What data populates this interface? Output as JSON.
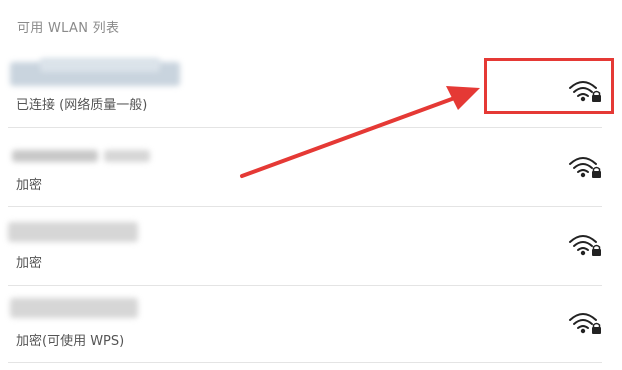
{
  "section": {
    "title": "可用 WLAN 列表"
  },
  "networks": [
    {
      "status": "已连接 (网络质量一般)",
      "icon": "wifi-lock-icon"
    },
    {
      "status": "加密",
      "icon": "wifi-lock-icon"
    },
    {
      "status": "加密",
      "icon": "wifi-lock-icon"
    },
    {
      "status": "加密(可使用 WPS)",
      "icon": "wifi-lock-icon"
    }
  ],
  "colors": {
    "annotation": "#e53935",
    "icon": "#222222",
    "divider": "#e4e4e4"
  }
}
